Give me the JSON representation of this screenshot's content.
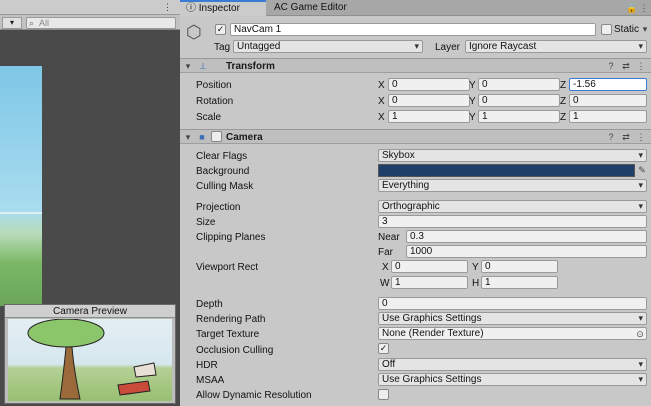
{
  "scene": {
    "search_placeholder": "All"
  },
  "preview": {
    "title": "Camera Preview"
  },
  "tabs": {
    "inspector": "Inspector",
    "ac_editor": "AC Game Editor"
  },
  "object": {
    "name": "NavCam 1",
    "static_label": "Static",
    "tag_label": "Tag",
    "tag_value": "Untagged",
    "layer_label": "Layer",
    "layer_value": "Ignore Raycast"
  },
  "transform": {
    "title": "Transform",
    "rows": [
      {
        "label": "Position",
        "x": "0",
        "y": "0",
        "z": "-1.56"
      },
      {
        "label": "Rotation",
        "x": "0",
        "y": "0",
        "z": "0"
      },
      {
        "label": "Scale",
        "x": "1",
        "y": "1",
        "z": "1"
      }
    ],
    "axis_x": "X",
    "axis_y": "Y",
    "axis_z": "Z"
  },
  "camera": {
    "title": "Camera",
    "clear_flags": {
      "label": "Clear Flags",
      "value": "Skybox"
    },
    "background": {
      "label": "Background",
      "color": "#1f3f69"
    },
    "culling_mask": {
      "label": "Culling Mask",
      "value": "Everything"
    },
    "projection": {
      "label": "Projection",
      "value": "Orthographic"
    },
    "size": {
      "label": "Size",
      "value": "3"
    },
    "clipping": {
      "label": "Clipping Planes",
      "near_label": "Near",
      "near": "0.3",
      "far_label": "Far",
      "far": "1000"
    },
    "viewport": {
      "label": "Viewport Rect",
      "x_label": "X",
      "x": "0",
      "y_label": "Y",
      "y": "0",
      "w_label": "W",
      "w": "1",
      "h_label": "H",
      "h": "1"
    },
    "depth": {
      "label": "Depth",
      "value": "0"
    },
    "rendering_path": {
      "label": "Rendering Path",
      "value": "Use Graphics Settings"
    },
    "target_texture": {
      "label": "Target Texture",
      "value": "None (Render Texture)"
    },
    "occlusion": {
      "label": "Occlusion Culling",
      "value": "✓"
    },
    "hdr": {
      "label": "HDR",
      "value": "Off"
    },
    "msaa": {
      "label": "MSAA",
      "value": "Use Graphics Settings"
    },
    "dynamic_res": {
      "label": "Allow Dynamic Resolution"
    }
  }
}
